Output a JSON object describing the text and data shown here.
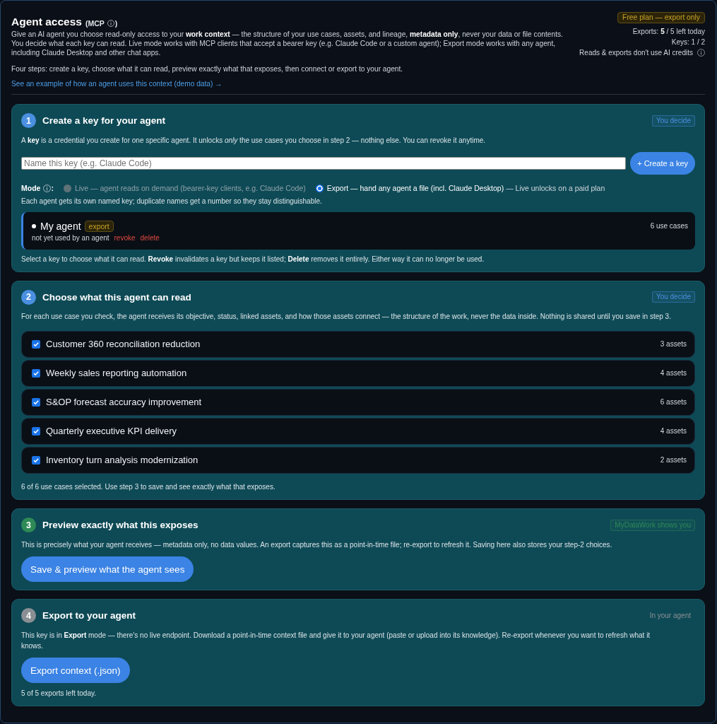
{
  "header": {
    "title": "Agent access",
    "title_tag_open": "(MCP",
    "title_tag_close": ")",
    "intro": "Give an AI agent you choose read-only access to your **work context** — the structure of your use cases, assets, and lineage, **metadata only**, never your data or file contents. You decide what each key can read. Live mode works with MCP clients that accept a bearer key (e.g. Claude Code or a custom agent); Export mode works with any agent, including Claude Desktop and other chat apps.",
    "steps_summary": "Four steps: create a key, choose what it can read, preview exactly what that exposes, then connect or export to your agent.",
    "example_link": "See an example of how an agent uses this context (demo data) →"
  },
  "plan": {
    "badge": "Free plan — export only",
    "exports": "Exports: **5** / 5 left today",
    "keys": "Keys: 1 / 2",
    "credits_note": "Reads & exports don't use AI credits"
  },
  "steps": [
    {
      "kind": "create_key",
      "number": "1",
      "title": "Create a key for your agent",
      "color": "#4a8fe0",
      "tag": {
        "text": "You decide",
        "boxed": true
      },
      "description": "A **key** is a credential you create for one specific agent. It unlocks *only* the use cases you choose in step 2 — nothing else. You can revoke it anytime.",
      "name_field": {
        "placeholder": "Name this key (e.g. Claude Code)"
      },
      "create_button": "+ Create a key",
      "mode": {
        "label": "Mode",
        "colon": ":",
        "options": [
          {
            "label": "Live — agent reads on demand (bearer-key clients, e.g. Claude Code)",
            "selected": false,
            "disabled": true
          },
          {
            "label": "Export — hand any agent a file (incl. Claude Desktop)",
            "selected": true,
            "disabled": false
          }
        ],
        "upsell": "— Live unlocks on a paid plan"
      },
      "naming_note": "Each agent gets its own named key; duplicate names get a number so they stay distinguishable.",
      "keys": [
        {
          "name": "My agent",
          "mode_badge": "export",
          "status": "not yet used by an agent",
          "revoke": "revoke",
          "delete": "delete",
          "use_cases": "6 use cases",
          "selected": true
        }
      ],
      "footnote": "Select a key to choose what it can read. **Revoke** invalidates a key but keeps it listed; **Delete** removes it entirely. Either way it can no longer be used."
    },
    {
      "kind": "choose",
      "number": "2",
      "title": "Choose what this agent can read",
      "color": "#4a8fe0",
      "tag": {
        "text": "You decide",
        "boxed": true
      },
      "description": "For each use case you check, the agent receives its objective, status, linked assets, and how those assets connect — the structure of the work, never the data inside. Nothing is shared until you save in step 3.",
      "use_cases": [
        {
          "name": "Customer 360 reconciliation reduction",
          "assets": "3 assets",
          "checked": true
        },
        {
          "name": "Weekly sales reporting automation",
          "assets": "4 assets",
          "checked": true
        },
        {
          "name": "S&OP forecast accuracy improvement",
          "assets": "6 assets",
          "checked": true
        },
        {
          "name": "Quarterly executive KPI delivery",
          "assets": "4 assets",
          "checked": true
        },
        {
          "name": "Inventory turn analysis modernization",
          "assets": "2 assets",
          "checked": true
        }
      ],
      "summary": "6 of 6 use cases selected. Use step 3 to save and see exactly what that exposes."
    },
    {
      "kind": "preview",
      "number": "3",
      "title": "Preview exactly what this exposes",
      "color": "#2e8a56",
      "tag": {
        "text": "MyDataWork shows you",
        "boxed": true
      },
      "description": "This is precisely what your agent receives — metadata only, no data values. An export captures this as a point-in-time file; re-export to refresh it. Saving here also stores your step-2 choices.",
      "button": "Save & preview what the agent sees"
    },
    {
      "kind": "export",
      "number": "4",
      "title": "Export to your agent",
      "color": "#8a8f93",
      "tag": {
        "text": "In your agent",
        "boxed": false
      },
      "description": "This key is in **Export** mode — there's no live endpoint. Download a point-in-time context file and give it to your agent (paste or upload into its knowledge). Re-export whenever you want to refresh what it knows.",
      "button": "Export context (.json)",
      "note": "5 of 5 exports left today."
    }
  ]
}
